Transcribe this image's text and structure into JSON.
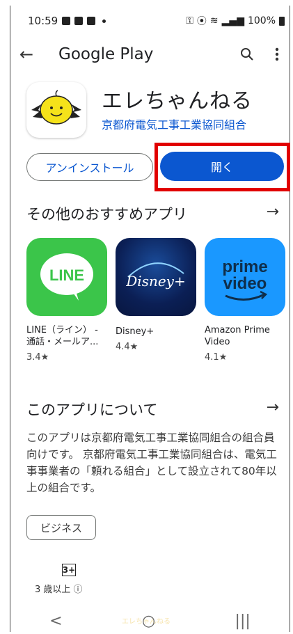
{
  "status_bar": {
    "time": "10:59",
    "battery": "100%"
  },
  "app_bar": {
    "title": "Google Play",
    "icons": [
      "back-arrow-icon",
      "search-icon",
      "more-vert-icon"
    ]
  },
  "app": {
    "name": "エレちゃんねる",
    "developer": "京都府電気工事工業協同組合",
    "uninstall_label": "アンインストール",
    "open_label": "開く"
  },
  "recommended": {
    "title": "その他のおすすめアプリ",
    "arrow": "→",
    "items": [
      {
        "name": "LINE（ライン） - 通話・メールア...",
        "rating": "3.4★",
        "tile_text": "LINE",
        "color": "#3bc54a"
      },
      {
        "name": "Disney+",
        "rating": "4.4★",
        "tile_text": "Disney+",
        "color": "#0b1f55"
      },
      {
        "name": "Amazon Prime Video",
        "rating": "4.1★",
        "tile_text": "prime video",
        "color": "#1a98ff"
      }
    ]
  },
  "about": {
    "title": "このアプリについて",
    "arrow": "→",
    "description": "このアプリは京都府電気工事工業協同組合の組合員向けです。 京都府電気工事工業協同組合は、電気工事事業者の「頼れる組合」として設立されて80年以上の組合です。",
    "category_chip": "ビジネス"
  },
  "content_rating": {
    "badge": "3+",
    "label": "3 歳以上 ⓘ"
  },
  "nav_bar": {
    "back": "<",
    "home": "○",
    "recents": "|||",
    "ghost_text": "エレちゃんねる"
  },
  "colors": {
    "accent": "#0b57d0",
    "highlight_border": "#e10000"
  }
}
